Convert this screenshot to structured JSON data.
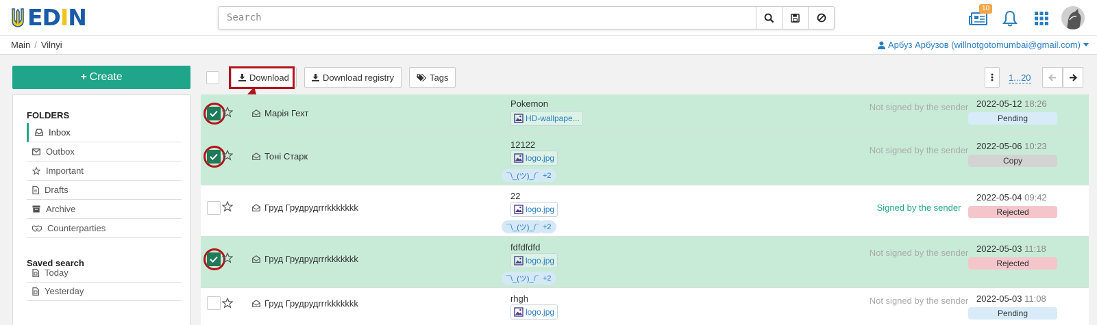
{
  "header": {
    "logo_text": "EDIN",
    "search_placeholder": "Search",
    "notifications_count": "10"
  },
  "breadcrumb": {
    "items": [
      "Main",
      "Vilnyi"
    ]
  },
  "user": {
    "label": "Арбуз Арбузов (willnotgotomumbai@gmail.com)"
  },
  "sidebar": {
    "create_label": "Create",
    "folders_title": "FOLDERS",
    "folders": [
      {
        "label": "Inbox",
        "icon": "inbox-icon",
        "active": true
      },
      {
        "label": "Outbox",
        "icon": "envelope-icon"
      },
      {
        "label": "Important",
        "icon": "star-icon"
      },
      {
        "label": "Drafts",
        "icon": "file-icon"
      },
      {
        "label": "Archive",
        "icon": "archive-icon"
      },
      {
        "label": "Counterparties",
        "icon": "handshake-icon"
      }
    ],
    "saved_title": "Saved search",
    "saved": [
      {
        "label": "Today",
        "icon": "calendar-icon"
      },
      {
        "label": "Yesterday",
        "icon": "calendar-icon"
      }
    ]
  },
  "toolbar": {
    "download_label": "Download",
    "download_registry_label": "Download registry",
    "tags_label": "Tags",
    "pager_range": "1...20"
  },
  "documents": [
    {
      "selected": true,
      "sender": "Марія Гехт",
      "subject": "Pokemon",
      "attachment": "HD-wallpape...",
      "tags": [],
      "signature": "Not signed by the sender",
      "signed": false,
      "date": "2022-05-12",
      "time": "18:26",
      "status": "Pending"
    },
    {
      "selected": true,
      "sender": "Тоні Старк",
      "subject": "12122",
      "attachment": "logo.jpg",
      "tags": [
        "¯\\_(ツ)_/¯",
        "+2"
      ],
      "signature": "Not signed by the sender",
      "signed": false,
      "date": "2022-05-06",
      "time": "10:23",
      "status": "Copy"
    },
    {
      "selected": false,
      "sender": "Груд Грудрудrrrkkkkkkk",
      "subject": "22",
      "attachment": "logo.jpg",
      "tags": [
        "¯\\_(ツ)_/¯",
        "+2"
      ],
      "signature": "Signed by the sender",
      "signed": true,
      "date": "2022-05-04",
      "time": "09:42",
      "status": "Rejected"
    },
    {
      "selected": true,
      "sender": "Груд Грудрудrrrkkkkkkk",
      "subject": "fdfdfdfd",
      "attachment": "logo.jpg",
      "tags": [
        "¯\\_(ツ)_/¯",
        "+2"
      ],
      "signature": "Not signed by the sender",
      "signed": false,
      "date": "2022-05-03",
      "time": "11:18",
      "status": "Rejected"
    },
    {
      "selected": false,
      "sender": "Груд Грудрудrrrkkkkkkk",
      "subject": "rhgh",
      "attachment": "logo.jpg",
      "tags": [],
      "signature": "Not signed by the sender",
      "signed": false,
      "date": "2022-05-03",
      "time": "11:08",
      "status": "Pending"
    }
  ],
  "colors": {
    "accent": "#1fa68a",
    "highlight": "#b5121b",
    "selected_row": "#c8ebd7",
    "link": "#2a7ec2"
  }
}
